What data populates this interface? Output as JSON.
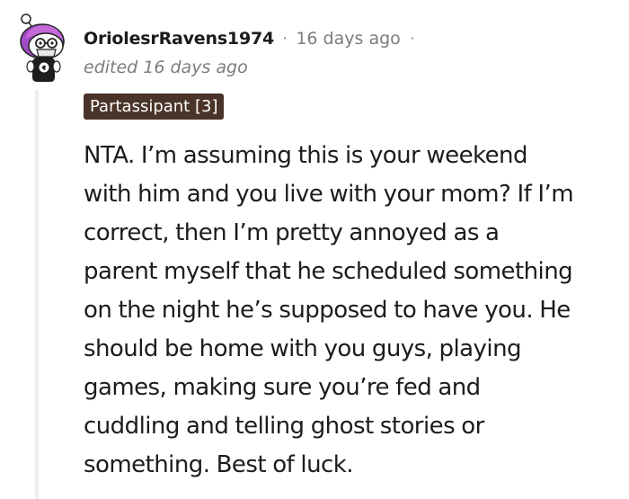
{
  "comment": {
    "author": "OriolesrRavens1974",
    "separator": "·",
    "timestamp": "16 days ago",
    "edited": "edited 16 days ago",
    "flair": "Partassipant [3]",
    "avatar_icon": "snoo-avatar-icon",
    "lines": [
      "NTA. I’m assuming this is your weekend",
      "with him and you live with your mom? If I’m",
      "correct, then I’m pretty annoyed as a",
      "parent myself that he scheduled something",
      "on the night he’s supposed to have you. He",
      "should be home with you guys, playing",
      "games, making sure you’re fed and",
      "cuddling and telling ghost stories or",
      "something. Best of luck."
    ]
  },
  "colors": {
    "flair_bg": "#4a3429",
    "avatar_hair": "#a34bc6",
    "text": "#1c1c1c",
    "meta": "#7c7c7c"
  }
}
